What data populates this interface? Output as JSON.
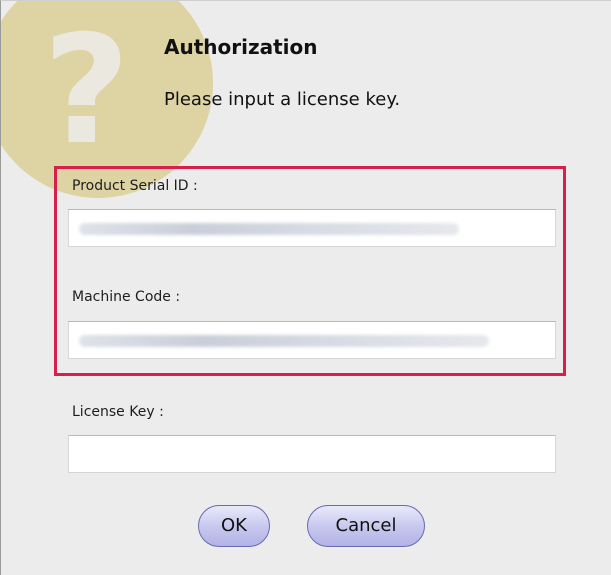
{
  "dialog": {
    "title": "Authorization",
    "message": "Please input a license key.",
    "icon": "question-mark-icon",
    "icon_glyph": "?",
    "accent_color": "#d81e4b"
  },
  "fields": {
    "serial_label": "Product Serial ID :",
    "serial_value": "",
    "machine_label": "Machine Code :",
    "machine_value": "",
    "license_label": "License Key :",
    "license_value": ""
  },
  "buttons": {
    "ok_label": "OK",
    "cancel_label": "Cancel"
  }
}
